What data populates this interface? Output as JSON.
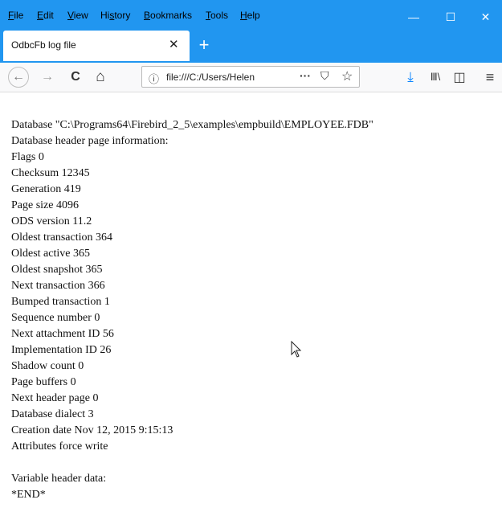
{
  "menu": [
    "File",
    "Edit",
    "View",
    "History",
    "Bookmarks",
    "Tools",
    "Help"
  ],
  "menu_underline": [
    "F",
    "E",
    "V",
    "s",
    "B",
    "T",
    "H"
  ],
  "window_buttons": [
    "—",
    "☐",
    "✕"
  ],
  "tab": {
    "title": "OdbcFb log file",
    "close": "✕"
  },
  "new_tab": "+",
  "nav": {
    "back": "←",
    "forward": "→",
    "reload": "C",
    "home": "⌂",
    "info": "ⓘ",
    "url": "file:///C:/Users/Helen",
    "more": "···",
    "pocket": "⛉",
    "star": "☆",
    "download": "⤓",
    "library": "Ⅲ\\",
    "sidebar": "◫",
    "menu": "≡"
  },
  "lines": [
    "Database \"C:\\Programs64\\Firebird_2_5\\examples\\empbuild\\EMPLOYEE.FDB\"",
    "Database header page information:",
    "Flags 0",
    "Checksum 12345",
    "Generation 419",
    "Page size 4096",
    "ODS version 11.2",
    "Oldest transaction 364",
    "Oldest active 365",
    "Oldest snapshot 365",
    "Next transaction 366",
    "Bumped transaction 1",
    "Sequence number 0",
    "Next attachment ID 56",
    "Implementation ID 26",
    "Shadow count 0",
    "Page buffers 0",
    "Next header page 0",
    "Database dialect 3",
    "Creation date Nov 12, 2015 9:15:13",
    "Attributes force write"
  ],
  "trailer": [
    "Variable header data:",
    "*END*"
  ],
  "colors": {
    "titlebar": "#2196f0",
    "navbar": "#f9f9fa",
    "download_accent": "#0a84ff"
  }
}
